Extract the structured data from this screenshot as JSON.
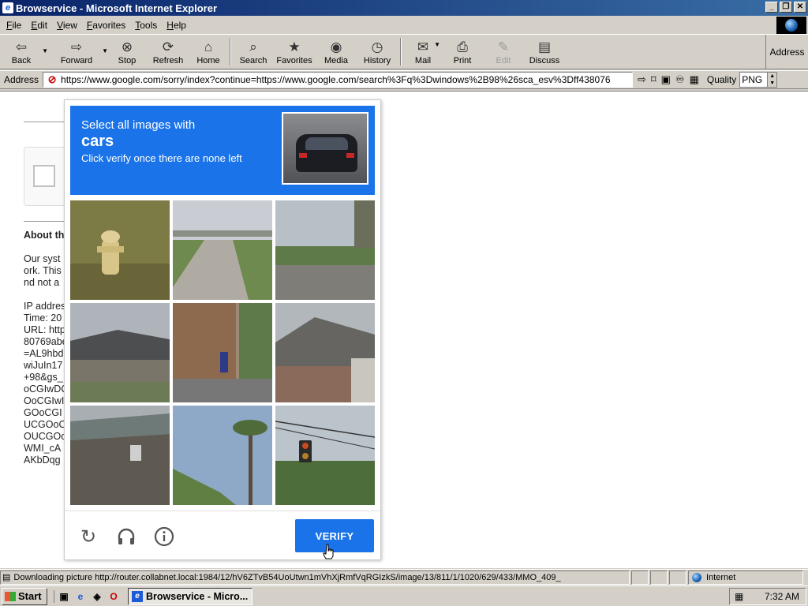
{
  "window": {
    "title": "Browservice - Microsoft Internet Explorer",
    "buttons": [
      "_",
      "❐",
      "✕"
    ]
  },
  "menu": [
    "File",
    "Edit",
    "View",
    "Favorites",
    "Tools",
    "Help"
  ],
  "toolbar": {
    "buttons": [
      {
        "label": "Back",
        "icon": "arrow-left-icon",
        "glyph": "⇦"
      },
      {
        "label": "Forward",
        "icon": "arrow-right-icon",
        "glyph": "⇨"
      },
      {
        "label": "Stop",
        "icon": "stop-icon",
        "glyph": "⊗"
      },
      {
        "label": "Refresh",
        "icon": "refresh-icon",
        "glyph": "⟳"
      },
      {
        "label": "Home",
        "icon": "home-icon",
        "glyph": "⌂"
      },
      {
        "label": "Search",
        "icon": "search-icon",
        "glyph": "⌕"
      },
      {
        "label": "Favorites",
        "icon": "favorites-icon",
        "glyph": "★"
      },
      {
        "label": "Media",
        "icon": "media-icon",
        "glyph": "◉"
      },
      {
        "label": "History",
        "icon": "history-icon",
        "glyph": "◷"
      },
      {
        "label": "Mail",
        "icon": "mail-icon",
        "glyph": "✉"
      },
      {
        "label": "Print",
        "icon": "print-icon",
        "glyph": "⎙"
      },
      {
        "label": "Edit",
        "icon": "edit-icon",
        "glyph": "✎"
      },
      {
        "label": "Discuss",
        "icon": "discuss-icon",
        "glyph": "▤"
      }
    ],
    "address_button": "Address"
  },
  "addressbar": {
    "label": "Address",
    "url": "https://www.google.com/sorry/index?continue=https://www.google.com/search%3Fq%3Dwindows%2B98%26sca_esv%3Dff438076",
    "quality_label": "Quality",
    "quality_value": "PNG"
  },
  "page": {
    "about_heading": "About th",
    "para_lines": [
      "Our syst",
      "ork. This",
      "nd not a"
    ],
    "info_lines": [
      "IP addres",
      "Time: 20",
      "URL: http",
      "80769abe",
      "=AL9hbd",
      "wiJuIn17",
      "+98&gs_",
      "oCGIwDC",
      "OoCGIwI",
      "GOoCGI",
      "UCGOoC",
      "OUCGOo",
      "WMI_cA",
      "AKbDqg"
    ]
  },
  "captcha": {
    "instruction_1": "Select all images with",
    "target": "cars",
    "instruction_2": "Click verify once there are none left",
    "tiles": [
      {
        "subject": "fire hydrant in grass"
      },
      {
        "subject": "road under overpass"
      },
      {
        "subject": "street with grass"
      },
      {
        "subject": "house with roof"
      },
      {
        "subject": "brick building street"
      },
      {
        "subject": "house roof"
      },
      {
        "subject": "overpass bridge"
      },
      {
        "subject": "palm tree"
      },
      {
        "subject": "traffic light"
      }
    ],
    "verify_label": "VERIFY",
    "colors": {
      "accent": "#1a73e8"
    }
  },
  "status": {
    "text": "Downloading picture http://router.collabnet.local:1984/12/hV6ZTvB54UoUtwn1mVhXjRmfVqRGIzkS/image/13/811/1/1020/629/433/MMO_409_",
    "zone": "Internet"
  },
  "taskbar": {
    "start_label": "Start",
    "task_label": "Browservice - Micro...",
    "clock": "7:32 AM"
  }
}
